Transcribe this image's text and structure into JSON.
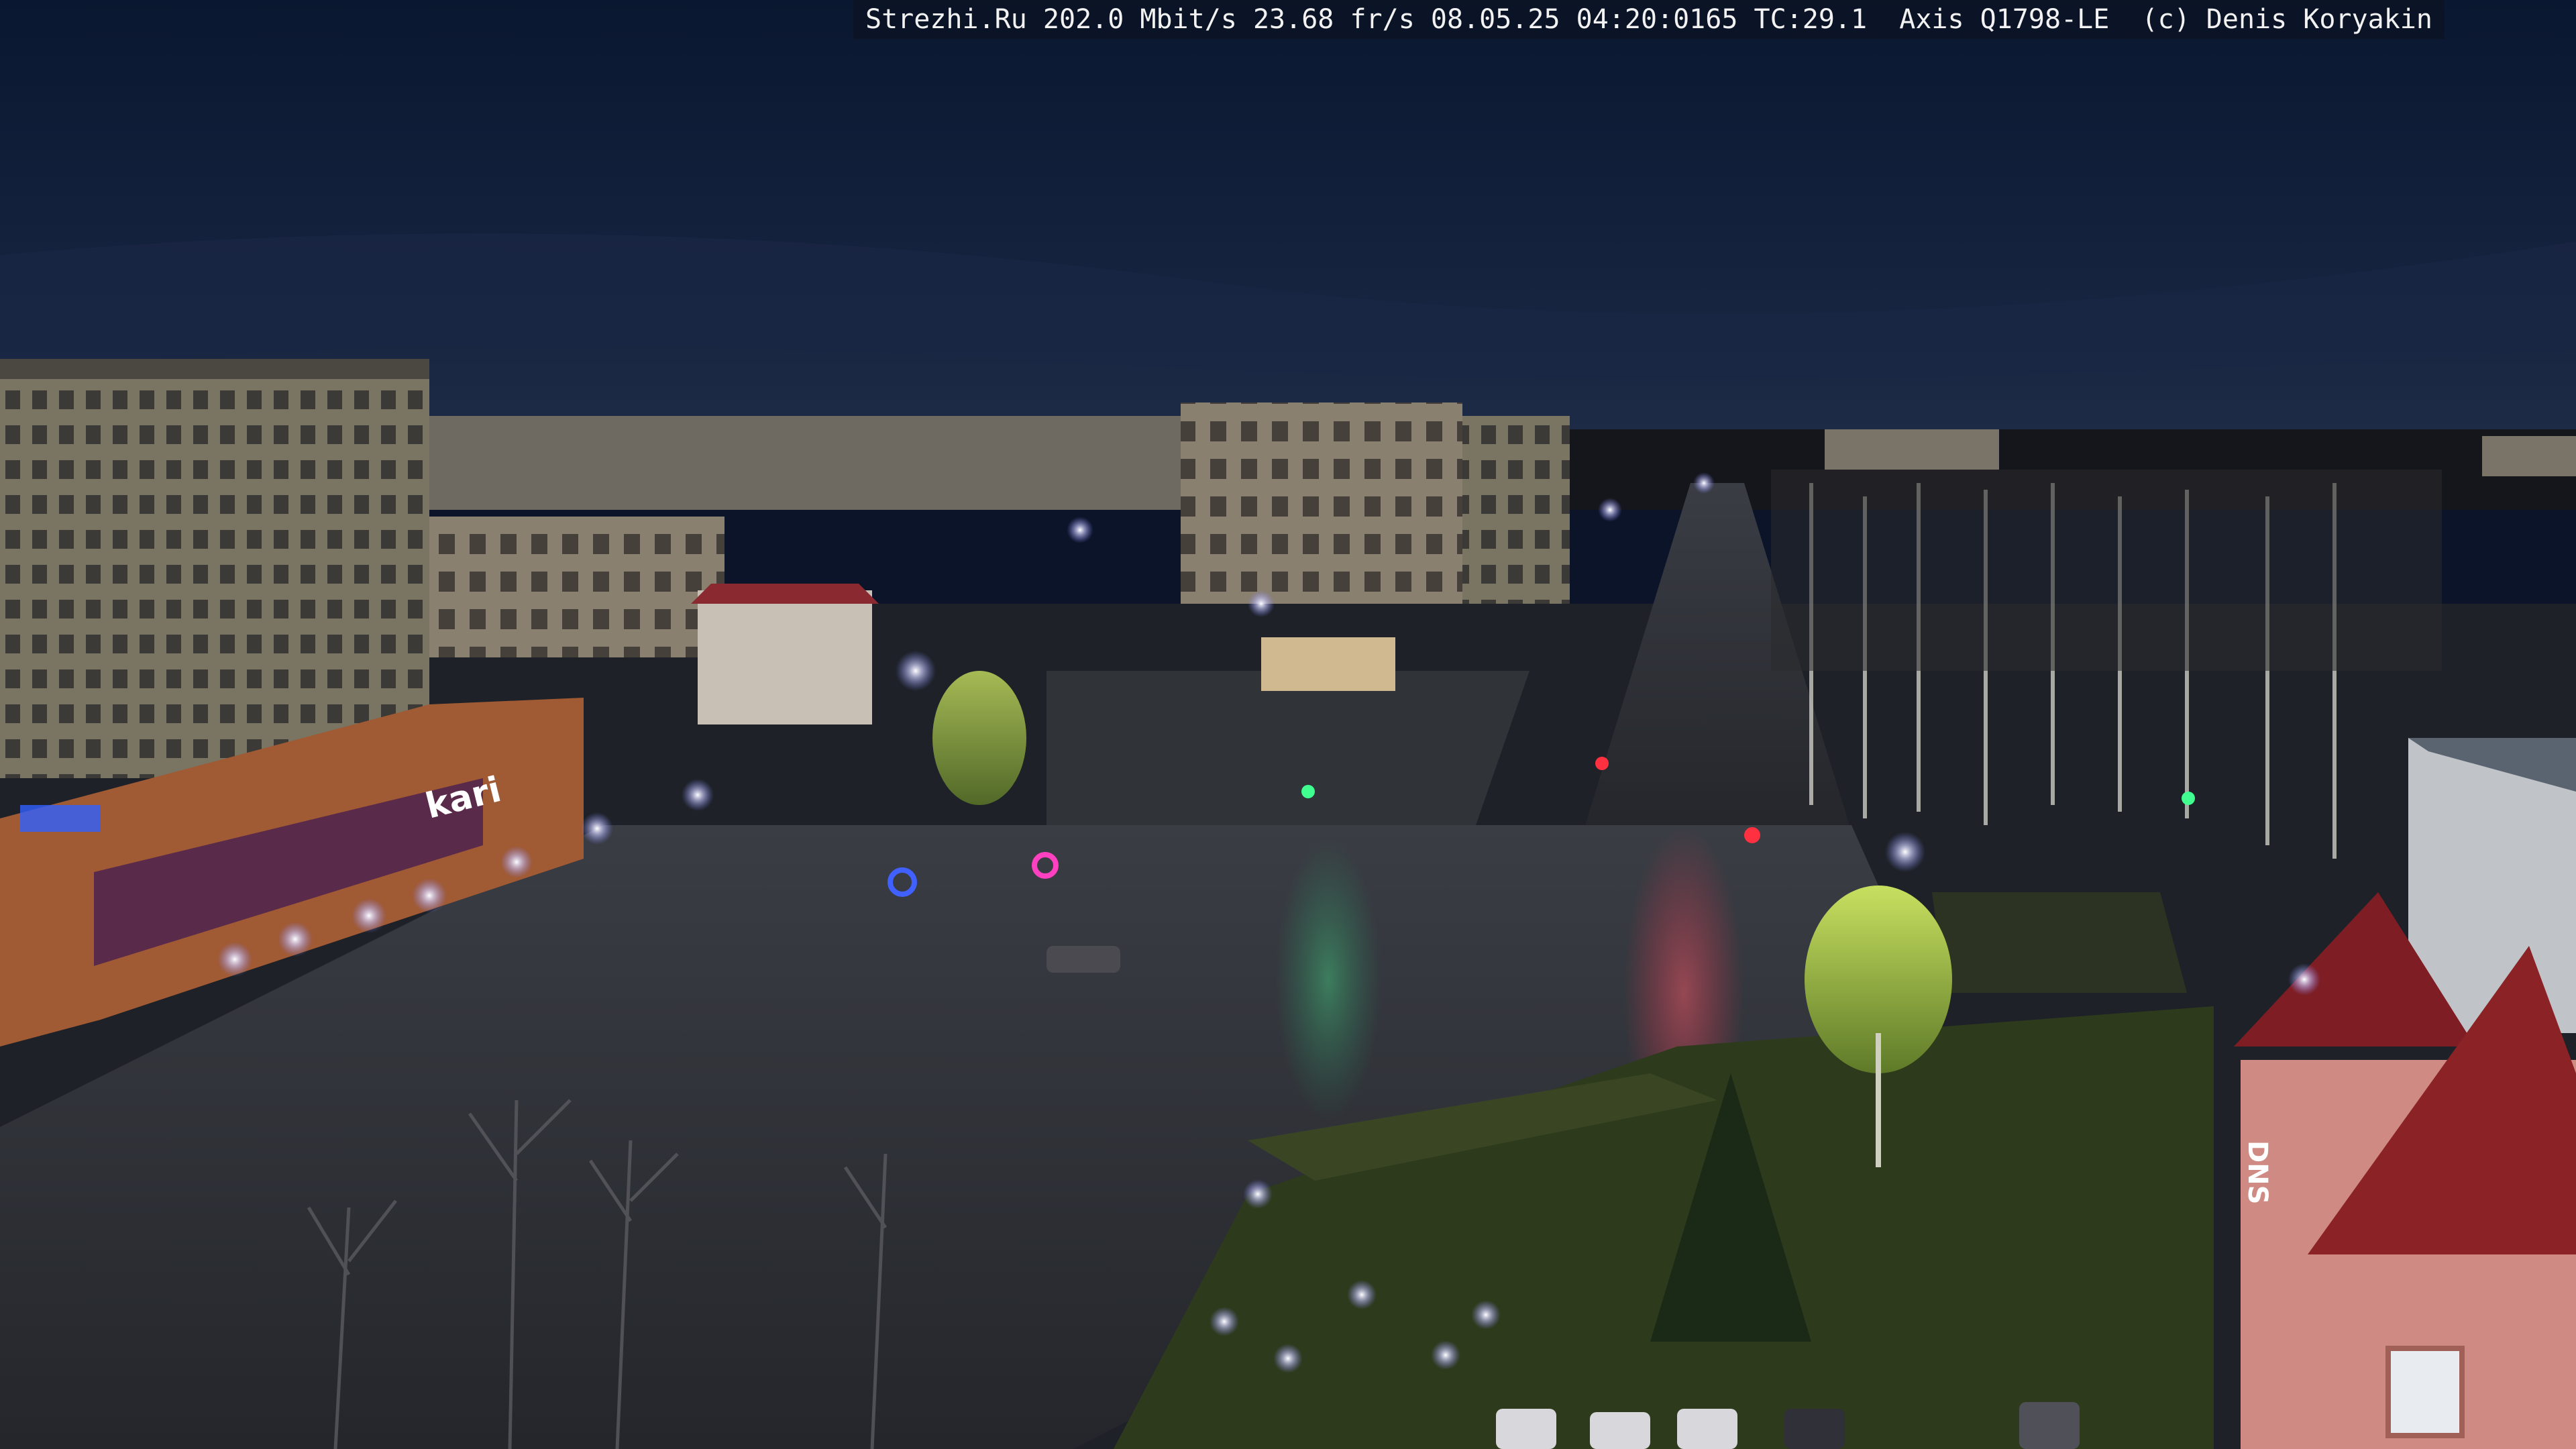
{
  "overlay": {
    "caption": "Strezhi.Ru 202.0 Mbit/s 23.68 fr/s 08.05.25 04:20:0165 TC:29.1  Axis Q1798-LE  (c) Denis Koryakin"
  },
  "signs": {
    "store_sign": "kari",
    "tower_sign": "DNS"
  },
  "colors": {
    "sky_top": "#0c1a33",
    "sky_horizon": "#1d2b48",
    "road": "#2a2d33",
    "grass": "#2f3a1f",
    "streetlight": "#e8e8ff",
    "building_brick": "#8a5a3a",
    "tower_red": "#9a2a2e"
  }
}
